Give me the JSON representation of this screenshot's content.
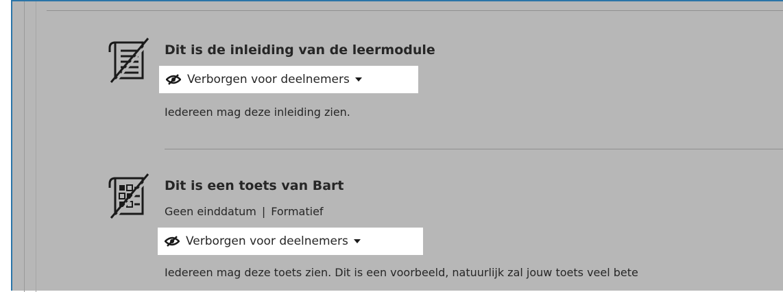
{
  "items": [
    {
      "icon": "document-icon",
      "title": "Dit is de inleiding van de leermodule",
      "visibility": "Verborgen voor deelnemers",
      "description": "Iedereen mag deze inleiding zien."
    },
    {
      "icon": "test-icon",
      "title": "Dit is een toets van Bart",
      "meta_due": "Geen einddatum",
      "meta_separator": "|",
      "meta_type": "Formatief",
      "visibility": "Verborgen voor deelnemers",
      "description": "Iedereen mag deze toets zien. Dit is een voorbeeld, natuurlijk zal jouw toets veel bete"
    }
  ],
  "colors": {
    "panel_background": "#b7b7b7",
    "pill_background": "#ffffff",
    "frame_border": "#2a74a8",
    "text": "#262626"
  }
}
